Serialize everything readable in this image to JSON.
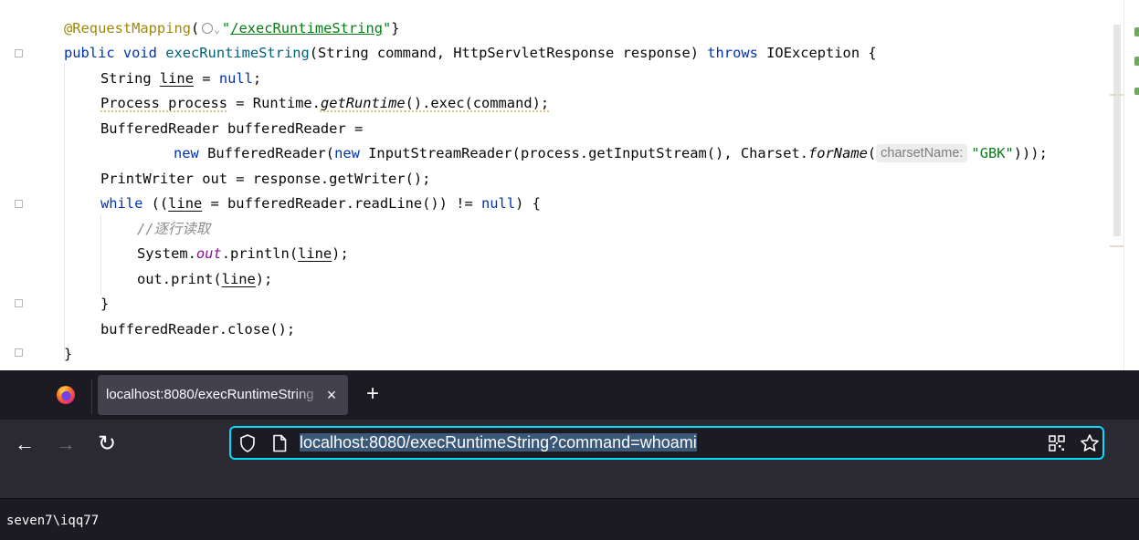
{
  "editor": {
    "annotation": "@RequestMapping",
    "mapping_paren_open": "(",
    "mapping_quote_open": "\"",
    "mapping_path": "/execRuntimeString",
    "mapping_close": "\")",
    "method_kw": "public void",
    "method_name": "execRuntimeString",
    "method_params": "(String command, HttpServletResponse response)",
    "throws_kw": "throws",
    "throws_rest": "IOException {",
    "l3_type": "String",
    "l3_var": "line",
    "l3_eq": "=",
    "l3_null": "null",
    "l3_end": ";",
    "l4_decl": "Process process",
    "l4_eq": " = Runtime.",
    "l4_call": "getRuntime",
    "l4_rest": "().exec(command);",
    "l5": "BufferedReader bufferedReader =",
    "l6_new1": "new",
    "l6_mid1": " BufferedReader(",
    "l6_new2": "new",
    "l6_mid2": " InputStreamReader(process.getInputStream(), Charset.",
    "l6_call": "forName",
    "l6_paren": "(",
    "l6_hint": "charsetName:",
    "l6_str": "\"GBK\"",
    "l6_end": ")));",
    "l7": "PrintWriter out = response.getWriter();",
    "l8_kw": "while",
    "l8_a": " ((",
    "l8_var": "line",
    "l8_b": " = bufferedReader.readLine()) != ",
    "l8_null": "null",
    "l8_c": ") {",
    "l9_comment": "//逐行读取",
    "l10_a": "System.",
    "l10_field": "out",
    "l10_b": ".println(",
    "l10_var": "line",
    "l10_c": ");",
    "l11_a": "out.print(",
    "l11_var": "line",
    "l11_b": ");",
    "l12": "}",
    "l13": "bufferedReader.close();",
    "l14": "}"
  },
  "browser": {
    "tab_title": "localhost:8080/execRuntimeString",
    "close_icon": "×",
    "new_tab_icon": "+",
    "back_icon": "←",
    "forward_icon": "→",
    "reload_icon": "↻",
    "url": "localhost:8080/execRuntimeString?command=whoami",
    "accent_color": "#00ddff"
  },
  "page": {
    "output": "seven7\\iqq77"
  }
}
